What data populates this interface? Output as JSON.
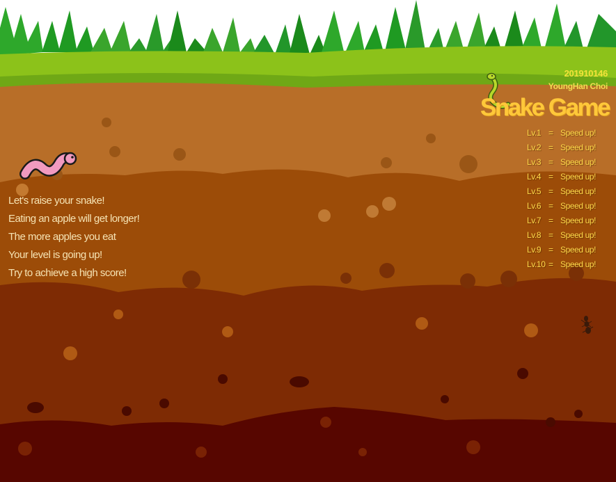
{
  "header": {
    "student_id": "201910146",
    "author": "YoungHan Choi",
    "title": "Snake Game"
  },
  "intro_lines": [
    "Let's raise your snake!",
    "Eating an apple will get longer!",
    "The more apples you eat",
    "Your level is going up!",
    "Try to achieve a high score!"
  ],
  "levels": [
    {
      "label": "Lv.1",
      "eq": "=",
      "text": "Speed up!"
    },
    {
      "label": "Lv.2",
      "eq": "=",
      "text": "Speed up!"
    },
    {
      "label": "Lv.3",
      "eq": "=",
      "text": "Speed up!"
    },
    {
      "label": "Lv.4",
      "eq": "=",
      "text": "Speed up!"
    },
    {
      "label": "Lv.5",
      "eq": "=",
      "text": "Speed up!"
    },
    {
      "label": "Lv.6",
      "eq": "=",
      "text": "Speed up!"
    },
    {
      "label": "Lv.7",
      "eq": "=",
      "text": "Speed up!"
    },
    {
      "label": "Lv.8",
      "eq": "=",
      "text": "Speed up!"
    },
    {
      "label": "Lv.9",
      "eq": "=",
      "text": "Speed up!"
    },
    {
      "label": "Lv.10",
      "eq": "=",
      "text": "Speed up!"
    }
  ],
  "decor": {
    "worm": "pink-worm-icon",
    "snake": "snake-icon",
    "ant": "ant-icon"
  },
  "colors": {
    "grass_dark": "#1f8f1f",
    "grass_light": "#8cc21a",
    "soil_1": "#b86e28",
    "soil_2": "#9c4c08",
    "soil_3": "#7e2b04",
    "soil_4": "#570600",
    "title": "#ffc83a"
  }
}
